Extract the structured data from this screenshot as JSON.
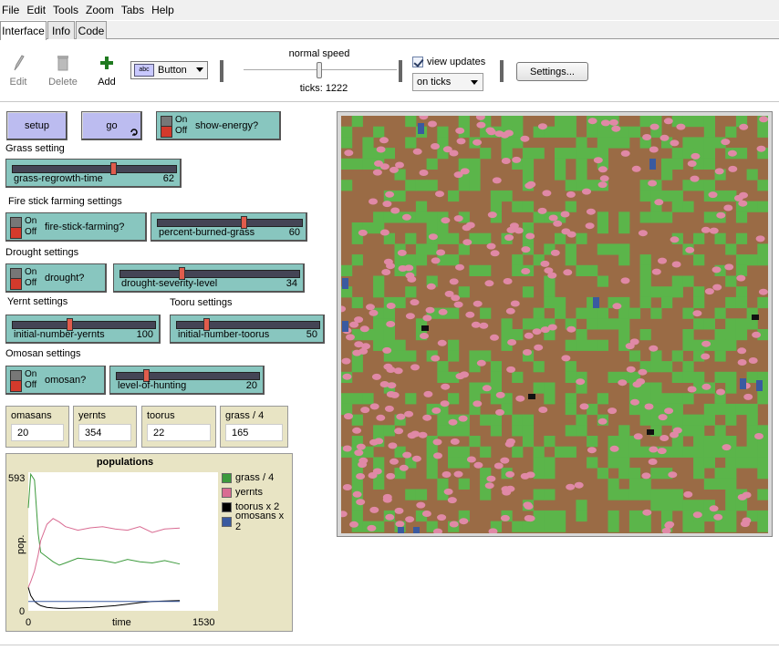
{
  "menu": [
    "File",
    "Edit",
    "Tools",
    "Zoom",
    "Tabs",
    "Help"
  ],
  "tabs": [
    "Interface",
    "Info",
    "Code"
  ],
  "toolbar": {
    "edit": "Edit",
    "delete": "Delete",
    "add": "Add",
    "widget_type": "Button",
    "speed_label": "normal speed",
    "ticks_label": "ticks: 1222",
    "view_updates": "view updates",
    "update_mode": "on ticks",
    "settings": "Settings..."
  },
  "buttons": {
    "setup": "setup",
    "go": "go"
  },
  "switches": {
    "show_energy": {
      "label": "show-energy?",
      "on": "On",
      "off": "Off"
    },
    "fire_stick": {
      "label": "fire-stick-farming?",
      "on": "On",
      "off": "Off"
    },
    "drought": {
      "label": "drought?",
      "on": "On",
      "off": "Off"
    },
    "omosan": {
      "label": "omosan?",
      "on": "On",
      "off": "Off"
    }
  },
  "notes": {
    "grass": "Grass setting",
    "fire": "Fire stick farming settings",
    "drought": "Drought settings",
    "yernt": "Yernt settings",
    "tooru": "Tooru settings",
    "omosan": "Omosan settings"
  },
  "sliders": {
    "grass_regrowth": {
      "label": "grass-regrowth-time",
      "value": "62",
      "fraction": 0.62
    },
    "percent_burned": {
      "label": "percent-burned-grass",
      "value": "60",
      "fraction": 0.6
    },
    "drought_severity": {
      "label": "drought-severity-level",
      "value": "34",
      "fraction": 0.34
    },
    "initial_yernts": {
      "label": "initial-number-yernts",
      "value": "100",
      "fraction": 0.4
    },
    "initial_toorus": {
      "label": "initial-number-toorus",
      "value": "50",
      "fraction": 0.2
    },
    "level_hunting": {
      "label": "level-of-hunting",
      "value": "20",
      "fraction": 0.2
    }
  },
  "monitors": [
    {
      "label": "omasans",
      "value": "20"
    },
    {
      "label": "yernts",
      "value": "354"
    },
    {
      "label": "toorus",
      "value": "22"
    },
    {
      "label": "grass / 4",
      "value": "165"
    }
  ],
  "chart_data": {
    "type": "line",
    "title": "populations",
    "xlabel": "time",
    "ylabel": "pop.",
    "xlim": [
      0,
      1530
    ],
    "ylim": [
      0,
      593
    ],
    "x_tick_labels": [
      "0",
      "1530"
    ],
    "y_tick_labels": [
      "0",
      "593"
    ],
    "legend_position": "right",
    "x": [
      0,
      20,
      50,
      80,
      100,
      150,
      200,
      250,
      300,
      400,
      500,
      600,
      700,
      800,
      900,
      1000,
      1100,
      1222
    ],
    "series": [
      {
        "name": "grass / 4",
        "color": "#3c9a3c",
        "values": [
          440,
          585,
          560,
          330,
          250,
          230,
          210,
          195,
          205,
          225,
          220,
          215,
          205,
          220,
          210,
          205,
          215,
          200
        ]
      },
      {
        "name": "yernts",
        "color": "#d96b92",
        "values": [
          100,
          125,
          170,
          240,
          300,
          370,
          395,
          380,
          360,
          345,
          355,
          360,
          350,
          345,
          360,
          335,
          350,
          354
        ]
      },
      {
        "name": "toorus x 2",
        "color": "#000000",
        "values": [
          100,
          65,
          40,
          28,
          22,
          15,
          12,
          10,
          10,
          12,
          14,
          18,
          22,
          28,
          35,
          40,
          42,
          44
        ]
      },
      {
        "name": "omosans x 2",
        "color": "#3a5aa0",
        "values": [
          40,
          40,
          40,
          40,
          40,
          40,
          40,
          40,
          40,
          40,
          40,
          40,
          40,
          40,
          40,
          40,
          40,
          40
        ]
      }
    ]
  },
  "world": {
    "colors": {
      "ground": "#9a6b45",
      "grass": "#5bb54a",
      "yernt": "#e089a6",
      "tooru": "#111111",
      "omosan": "#3a5aa0"
    }
  }
}
